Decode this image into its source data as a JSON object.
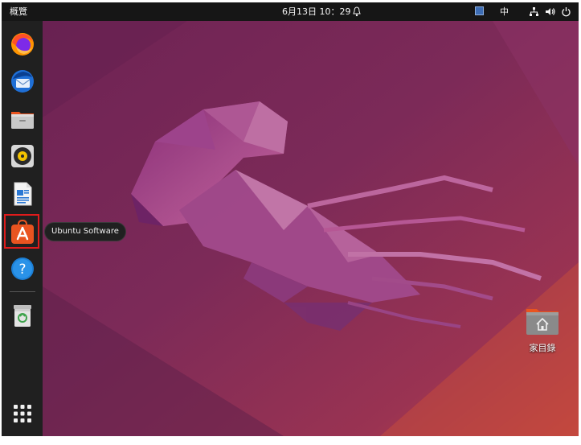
{
  "topbar": {
    "activities": "概覽",
    "clock": "6月13日 10：29",
    "ime": "中",
    "icons": [
      "alarm-bell-icon",
      "keyboard-layout-icon",
      "network-icon",
      "volume-icon",
      "power-icon"
    ]
  },
  "dock": {
    "items": [
      {
        "name": "firefox",
        "icon": "firefox-icon"
      },
      {
        "name": "thunderbird",
        "icon": "thunderbird-icon"
      },
      {
        "name": "files",
        "icon": "files-icon"
      },
      {
        "name": "rhythmbox",
        "icon": "rhythmbox-icon"
      },
      {
        "name": "libreoffice-writer",
        "icon": "libreoffice-writer-icon"
      },
      {
        "name": "ubuntu-software",
        "icon": "ubuntu-software-icon",
        "highlighted": true
      },
      {
        "name": "help",
        "icon": "help-icon"
      },
      {
        "name": "trash",
        "icon": "trash-icon"
      },
      {
        "name": "show-applications",
        "icon": "app-grid-icon"
      }
    ],
    "tooltip": "Ubuntu Software"
  },
  "desktop": {
    "home_label": "家目錄"
  },
  "colors": {
    "topbar": "#161616",
    "dock": "#202020",
    "highlight": "#e01b1b",
    "ubuntu_orange": "#e95420"
  }
}
